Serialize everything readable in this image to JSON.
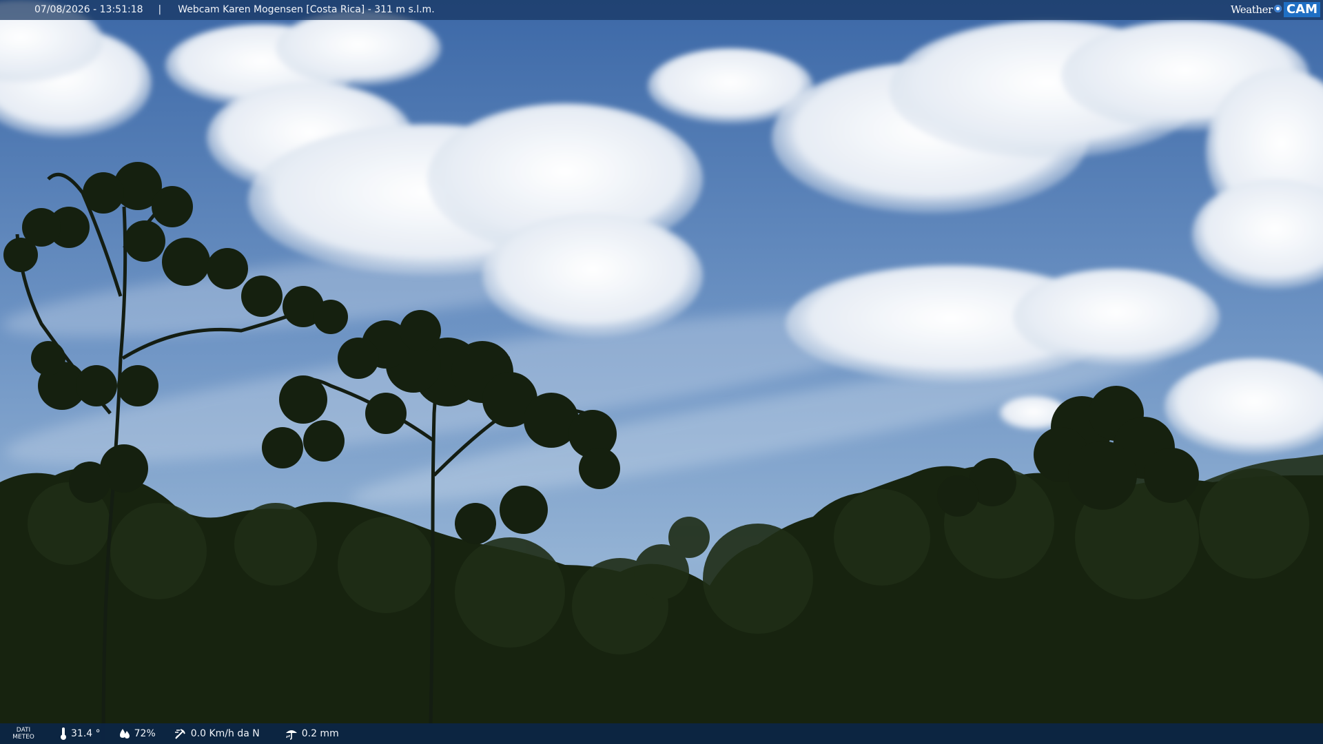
{
  "overlay": {
    "timestamp": "07/08/2026 - 13:51:18",
    "separator": "|",
    "title": "Webcam Karen Mogensen [Costa Rica] - 311 m s.l.m.",
    "logo_weather": "Weather",
    "logo_cam": "CAM"
  },
  "weather": {
    "label_line1": "DATI",
    "label_line2": "METEO",
    "temperature": "31.4 °",
    "humidity": "72%",
    "wind": "0.0 Km/h da N",
    "rain": "0.2 mm"
  },
  "icons": {
    "temperature": "thermometer-icon",
    "humidity": "humidity-drop-icon",
    "wind": "wind-vane-icon",
    "rain": "rain-gauge-icon",
    "logo": "weathercam-logo"
  },
  "colors": {
    "sky_top": "#3f6aa8",
    "sky_bottom": "#8fb0d4",
    "foliage": "#17230f",
    "bar": "#163460"
  }
}
